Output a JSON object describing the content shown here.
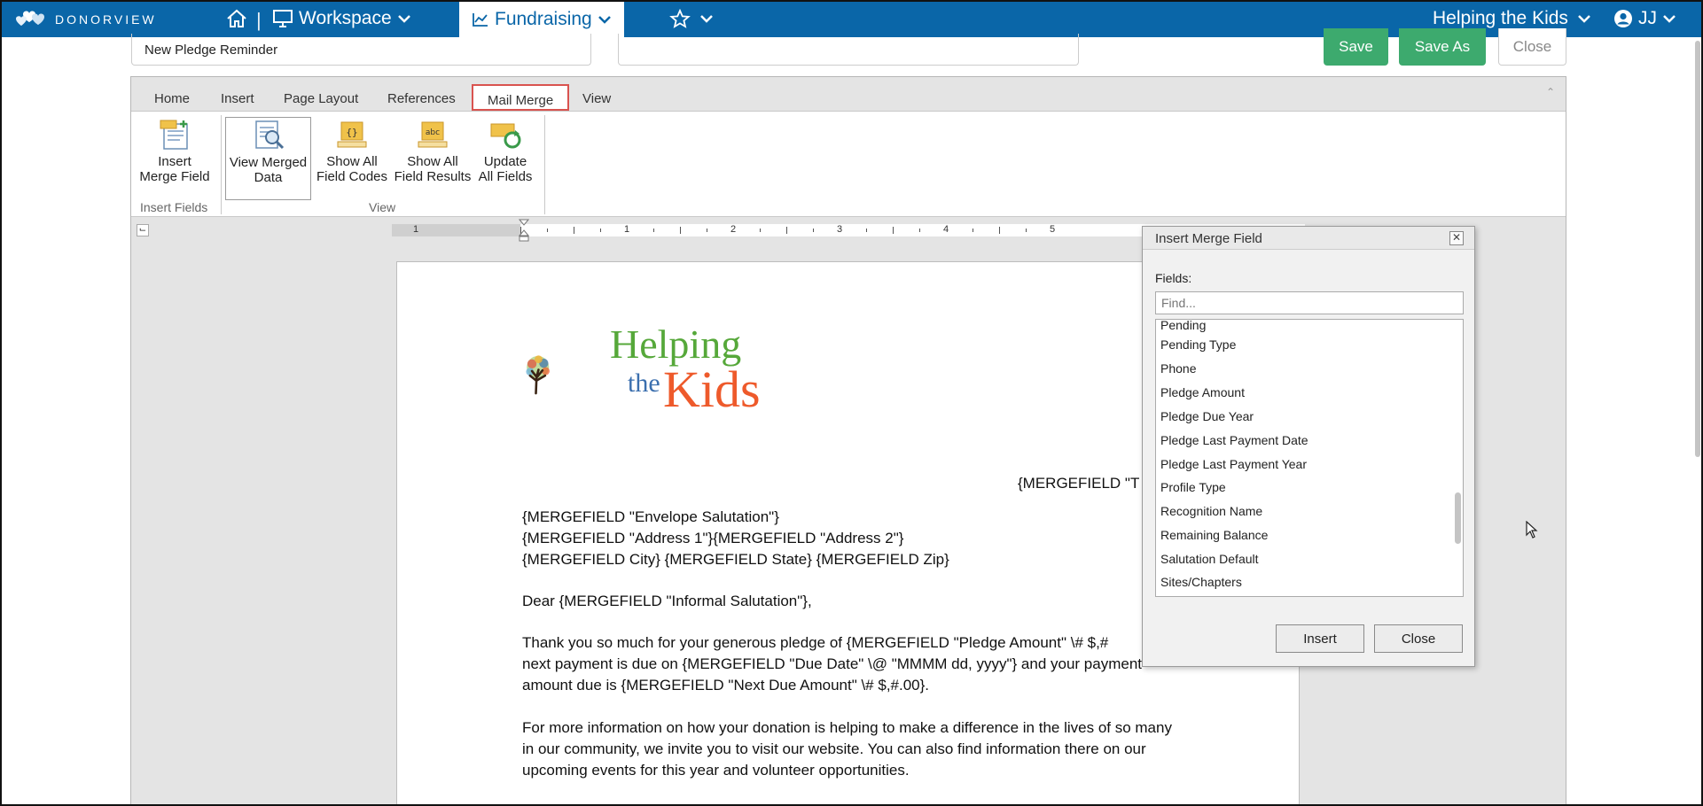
{
  "app": {
    "logo_text": "DONORVIEW"
  },
  "nav": {
    "workspace_label": "Workspace",
    "fundraising_label": "Fundraising",
    "org_label": "Helping the Kids",
    "user_label": "JJ"
  },
  "document": {
    "title": "New Pledge Reminder",
    "save_label": "Save",
    "save_as_label": "Save As",
    "close_label": "Close"
  },
  "ribbon": {
    "tabs": [
      {
        "label": "Home"
      },
      {
        "label": "Insert"
      },
      {
        "label": "Page Layout"
      },
      {
        "label": "References"
      },
      {
        "label": "Mail Merge",
        "active": true
      },
      {
        "label": "View"
      }
    ],
    "buttons": {
      "insert_merge_field": [
        "Insert",
        "Merge Field"
      ],
      "view_merged_data": [
        "View Merged",
        "Data"
      ],
      "show_field_codes": [
        "Show All",
        "Field Codes"
      ],
      "show_field_results": [
        "Show All",
        "Field Results"
      ],
      "update_fields": [
        "Update",
        "All Fields"
      ]
    },
    "groups": {
      "insert_fields": "Insert Fields",
      "view": "View"
    }
  },
  "ruler": {
    "numbers": [
      "1",
      "1",
      "2",
      "3",
      "4",
      "5"
    ]
  },
  "letter": {
    "logo": {
      "helping": "Helping",
      "the": "the",
      "kids": "Kids"
    },
    "date_field": "{MERGEFIELD \"T",
    "lines": [
      "{MERGEFIELD \"Envelope Salutation\"}",
      "{MERGEFIELD \"Address 1\"}{MERGEFIELD \"Address 2\"}",
      "{MERGEFIELD City} {MERGEFIELD State} {MERGEFIELD Zip}",
      "Dear {MERGEFIELD \"Informal Salutation\"},",
      "Thank you so much for your generous pledge of {MERGEFIELD \"Pledge Amount\" \\# $,#",
      "next payment is due on {MERGEFIELD \"Due Date\" \\@ \"MMMM dd, yyyy\"} and your payment",
      "amount due is {MERGEFIELD \"Next Due Amount\" \\# $,#.00}.",
      "For more information on how your donation is helping to make a difference in the lives of so many",
      "in our community, we invite you to visit our website. You can also find information there on our",
      "upcoming events for this year and volunteer opportunities."
    ]
  },
  "dialog": {
    "title": "Insert Merge Field",
    "fields_label": "Fields:",
    "find_placeholder": "Find...",
    "items": [
      "Pending",
      "Pending Type",
      "Phone",
      "Pledge Amount",
      "Pledge Due Year",
      "Pledge Last Payment Date",
      "Pledge Last Payment Year",
      "Profile Type",
      "Recognition Name",
      "Remaining Balance",
      "Salutation Default",
      "Sites/Chapters"
    ],
    "insert_label": "Insert",
    "close_label": "Close"
  },
  "colors": {
    "topbar": "#0a66a8",
    "save_green": "#3daa6e",
    "active_tab_border": "#d9534f"
  }
}
